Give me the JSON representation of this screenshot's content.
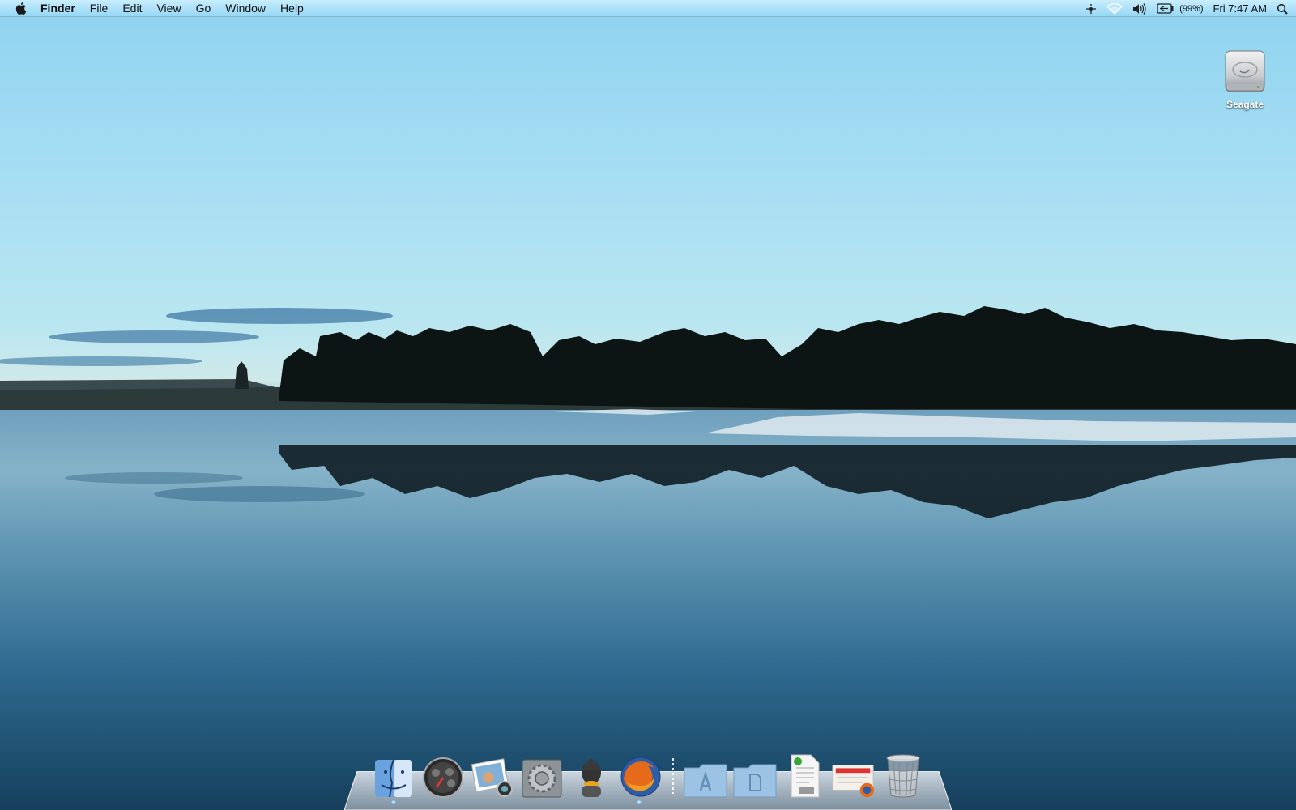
{
  "menubar": {
    "app_name": "Finder",
    "menus": [
      "File",
      "Edit",
      "View",
      "Go",
      "Window",
      "Help"
    ],
    "battery_percent": "(99%)",
    "clock": "Fri 7:47 AM"
  },
  "desktop": {
    "drive_label": "Seagate"
  },
  "dock": {
    "items": [
      {
        "name": "Finder",
        "icon": "finder-icon"
      },
      {
        "name": "Dashboard",
        "icon": "dashboard-icon"
      },
      {
        "name": "iPhoto",
        "icon": "iphoto-icon"
      },
      {
        "name": "System Preferences",
        "icon": "system-preferences-icon"
      },
      {
        "name": "Adium",
        "icon": "adium-icon"
      },
      {
        "name": "Firefox",
        "icon": "firefox-icon"
      }
    ],
    "stacks": [
      {
        "name": "Applications",
        "icon": "applications-folder-icon"
      },
      {
        "name": "Documents",
        "icon": "documents-folder-icon"
      },
      {
        "name": "PDF Document",
        "icon": "pdf-document-icon"
      },
      {
        "name": "Firefox Download",
        "icon": "firefox-download-icon"
      },
      {
        "name": "Trash",
        "icon": "trash-icon"
      }
    ]
  },
  "colors": {
    "sky_top": "#8fd3f0",
    "water_deep": "#174765",
    "menubar": "#a9def6"
  }
}
